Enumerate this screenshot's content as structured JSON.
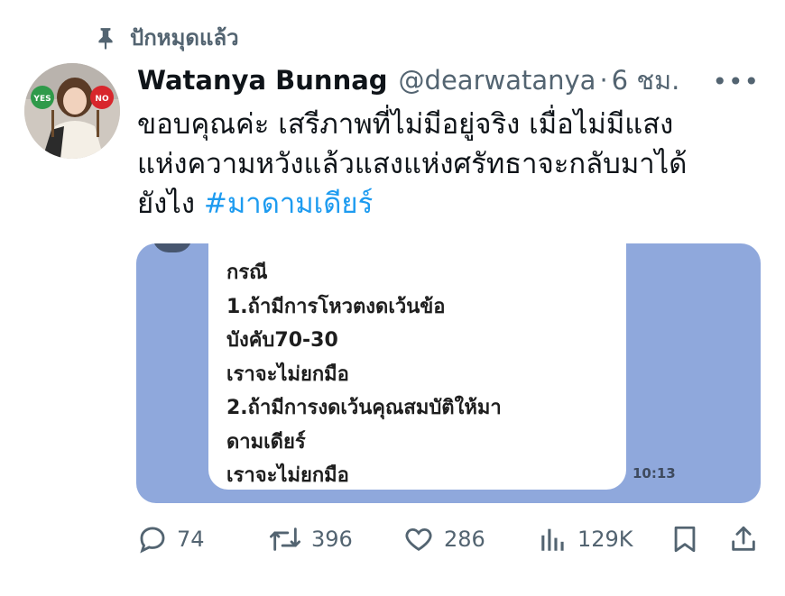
{
  "pinned": {
    "label": "ปักหมุดแล้ว",
    "icon": "pin-icon"
  },
  "author": {
    "display_name": "Watanya Bunnag",
    "handle": "@dearwatanya",
    "separator": "·",
    "timestamp": "6 ชม.",
    "avatar_signs": [
      "YES",
      "NO"
    ]
  },
  "tweet": {
    "lines": [
      "ขอบคุณค่ะ เสรีภาพที่ไม่มีอยู่จริง เมื่อไม่มีแสง",
      "แห่งความหวังแล้วแสงแห่งศรัทธาจะกลับมาได้",
      "ยังไง"
    ],
    "hashtag": "#มาดามเดียร์"
  },
  "media": {
    "chat_lines": [
      "กรณี",
      "1.ถ้ามีการโหวตงดเว้นข้อ",
      "บังคับ70-30",
      "เราจะไม่ยกมือ",
      "2.ถ้ามีการงดเว้นคุณสมบัติให้มา",
      "ดามเดียร์",
      "เราจะไม่ยกมือ"
    ],
    "time": "10:13"
  },
  "actions": {
    "reply_count": "74",
    "retweet_count": "396",
    "like_count": "286",
    "view_count": "129K"
  },
  "colors": {
    "text": "#0f1419",
    "secondary": "#536471",
    "link": "#1d9bf0",
    "media_bg": "#8fa8dc"
  }
}
